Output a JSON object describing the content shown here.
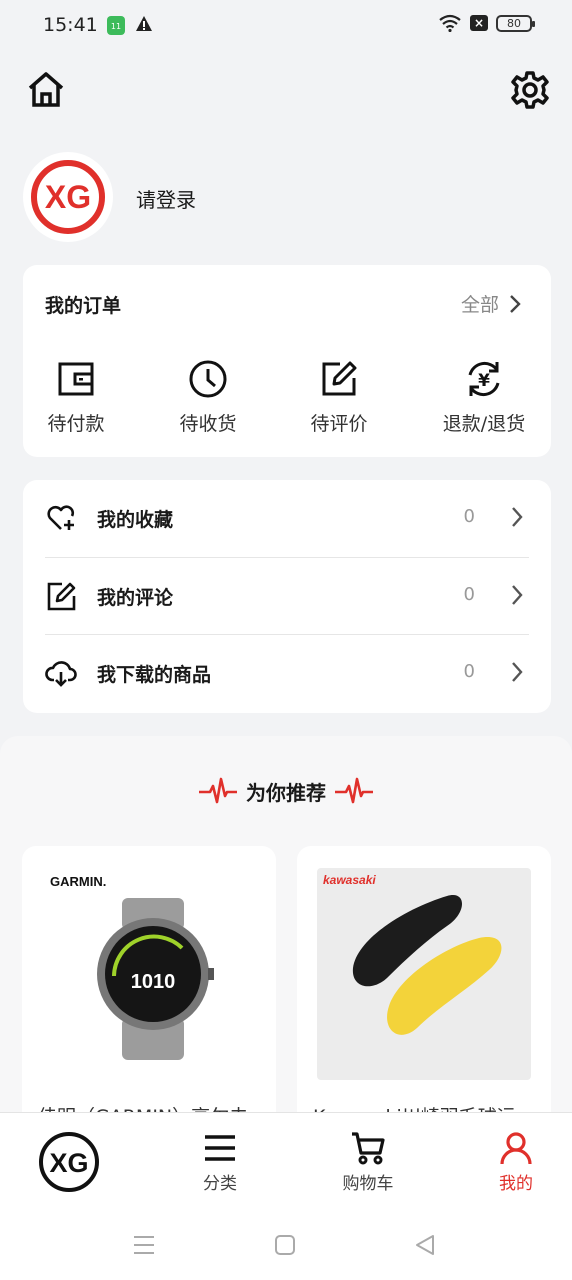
{
  "status_bar": {
    "time": "15:41",
    "app_badge": "11",
    "close_badge": "×",
    "battery": "80"
  },
  "profile": {
    "login_prompt": "请登录",
    "logo_text": "XG"
  },
  "orders": {
    "title": "我的订单",
    "all_label": "全部",
    "items": [
      {
        "label": "待付款",
        "icon": "wallet-icon"
      },
      {
        "label": "待收货",
        "icon": "clock-icon"
      },
      {
        "label": "待评价",
        "icon": "edit-icon"
      },
      {
        "label": "退款/退货",
        "icon": "refund-icon"
      }
    ]
  },
  "menu": {
    "items": [
      {
        "label": "我的收藏",
        "count": "0",
        "icon": "heart-plus-icon"
      },
      {
        "label": "我的评论",
        "count": "0",
        "icon": "edit-icon"
      },
      {
        "label": "我下载的商品",
        "count": "0",
        "icon": "cloud-download-icon"
      }
    ]
  },
  "recommend": {
    "title": "为你推荐",
    "products": [
      {
        "brand": "GARMIN.",
        "name": "佳明（GARMIN）高尔夫"
      },
      {
        "brand": "kawasaki",
        "name": "Kawasaki川崎羽毛球运"
      }
    ]
  },
  "bottom_nav": {
    "items": [
      {
        "label": "",
        "icon": "xg-logo-icon"
      },
      {
        "label": "分类",
        "icon": "menu-icon"
      },
      {
        "label": "购物车",
        "icon": "cart-icon"
      },
      {
        "label": "我的",
        "icon": "user-icon"
      }
    ],
    "active_index": 3,
    "active_color": "#e0302b"
  }
}
